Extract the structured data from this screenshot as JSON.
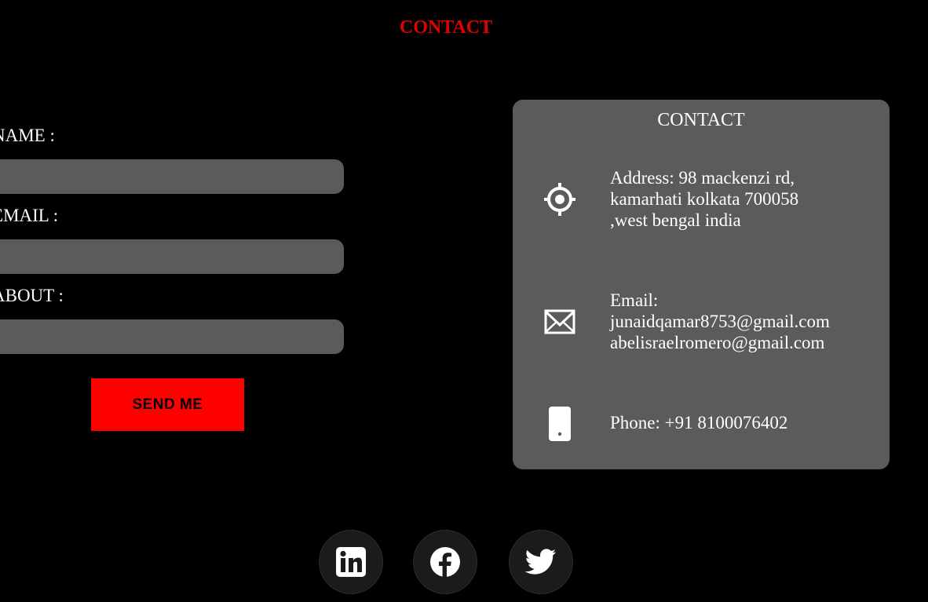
{
  "header": {
    "title": "CONTACT"
  },
  "form": {
    "fields": [
      {
        "label": "NAME :",
        "value": "",
        "placeholder": ""
      },
      {
        "label": "EMAIL :",
        "value": "",
        "placeholder": ""
      },
      {
        "label": "ABOUT :",
        "value": "",
        "placeholder": ""
      }
    ],
    "submit_label": "SEND ME"
  },
  "contact_card": {
    "title": "CONTACT",
    "address": {
      "icon": "location-crosshair-icon",
      "lines": [
        "Address: 98 mackenzi rd,",
        "kamarhati kolkata 700058",
        ",west bengal india"
      ]
    },
    "email": {
      "icon": "envelope-icon",
      "lines": [
        "Email:",
        "junaidqamar8753@gmail.com",
        "abelisraelromero@gmail.com"
      ]
    },
    "phone": {
      "icon": "mobile-phone-icon",
      "lines": [
        "Phone: +91 8100076402"
      ]
    }
  },
  "social": [
    {
      "icon": "linkedin-icon"
    },
    {
      "icon": "facebook-icon"
    },
    {
      "icon": "twitter-icon"
    }
  ],
  "colors": {
    "background": "#000000",
    "accent_red": "#ff0000",
    "title_red": "#e00000",
    "panel_gray": "#5c5b5c",
    "social_bg": "#1b1b1d"
  }
}
